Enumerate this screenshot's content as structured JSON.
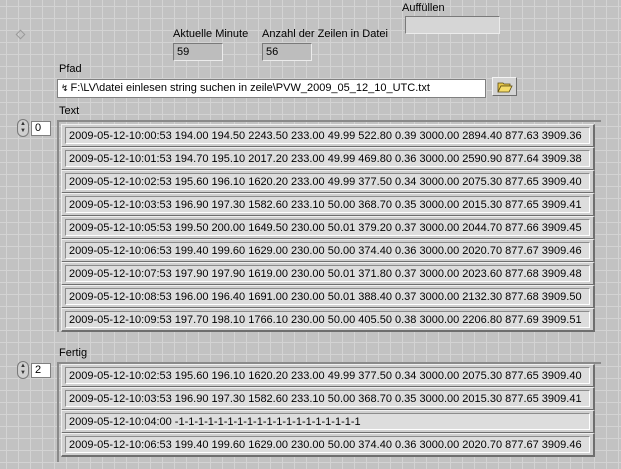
{
  "header": {
    "aktuelle_minute": {
      "label": "Aktuelle Minute",
      "value": "59"
    },
    "anzahl_zeilen": {
      "label": "Anzahl der Zeilen in Datei",
      "value": "56"
    },
    "auffuellen": {
      "label": "Auffüllen",
      "value": ""
    }
  },
  "pfad": {
    "label": "Pfad",
    "value": "F:\\LV\\datei einlesen string suchen in zeile\\PVW_2009_05_12_10_UTC.txt",
    "browse_icon": "folder-open-icon"
  },
  "text_array": {
    "label": "Text",
    "index": "0",
    "rows": [
      "2009-05-12-10:00:53 194.00 194.50 2243.50 233.00 49.99 522.80 0.39 3000.00 2894.40 877.63 3909.36",
      "2009-05-12-10:01:53 194.70 195.10 2017.20 233.00 49.99 469.80 0.36 3000.00 2590.90 877.64 3909.38",
      "2009-05-12-10:02:53 195.60 196.10 1620.20 233.00 49.99 377.50 0.34 3000.00 2075.30 877.65 3909.40",
      "2009-05-12-10:03:53 196.90 197.30 1582.60 233.10 50.00 368.70 0.35 3000.00 2015.30 877.65 3909.41",
      "2009-05-12-10:05:53 199.50 200.00 1649.50 230.00 50.01 379.20 0.37 3000.00 2044.70 877.66 3909.45",
      "2009-05-12-10:06:53 199.40 199.60 1629.00 230.00 50.00 374.40 0.36 3000.00 2020.70 877.67 3909.46",
      "2009-05-12-10:07:53 197.90 197.90 1619.00 230.00 50.01 371.80 0.37 3000.00 2023.60 877.68 3909.48",
      "2009-05-12-10:08:53 196.00 196.40 1691.00 230.00 50.01 388.40 0.37 3000.00 2132.30 877.68 3909.50",
      "2009-05-12-10:09:53 197.70 198.10 1766.10 230.00 50.00 405.50 0.38 3000.00 2206.80 877.69 3909.51"
    ]
  },
  "fertig_array": {
    "label": "Fertig",
    "index": "2",
    "rows": [
      "2009-05-12-10:02:53 195.60 196.10 1620.20 233.00 49.99 377.50 0.34 3000.00 2075.30 877.65 3909.40",
      "2009-05-12-10:03:53 196.90 197.30 1582.60 233.10 50.00 368.70 0.35 3000.00 2015.30 877.65 3909.41",
      "2009-05-12-10:04:00 -1-1-1-1-1-1-1-1-1-1-1-1-1-1-1-1-1-1-1",
      "2009-05-12-10:06:53 199.40 199.60 1629.00 230.00 50.00 374.40 0.36 3000.00 2020.70 877.67 3909.46"
    ]
  },
  "colors": {
    "background": "#c2c2c2",
    "indicator": "#bdbdbd",
    "cell": "#dddddd"
  }
}
